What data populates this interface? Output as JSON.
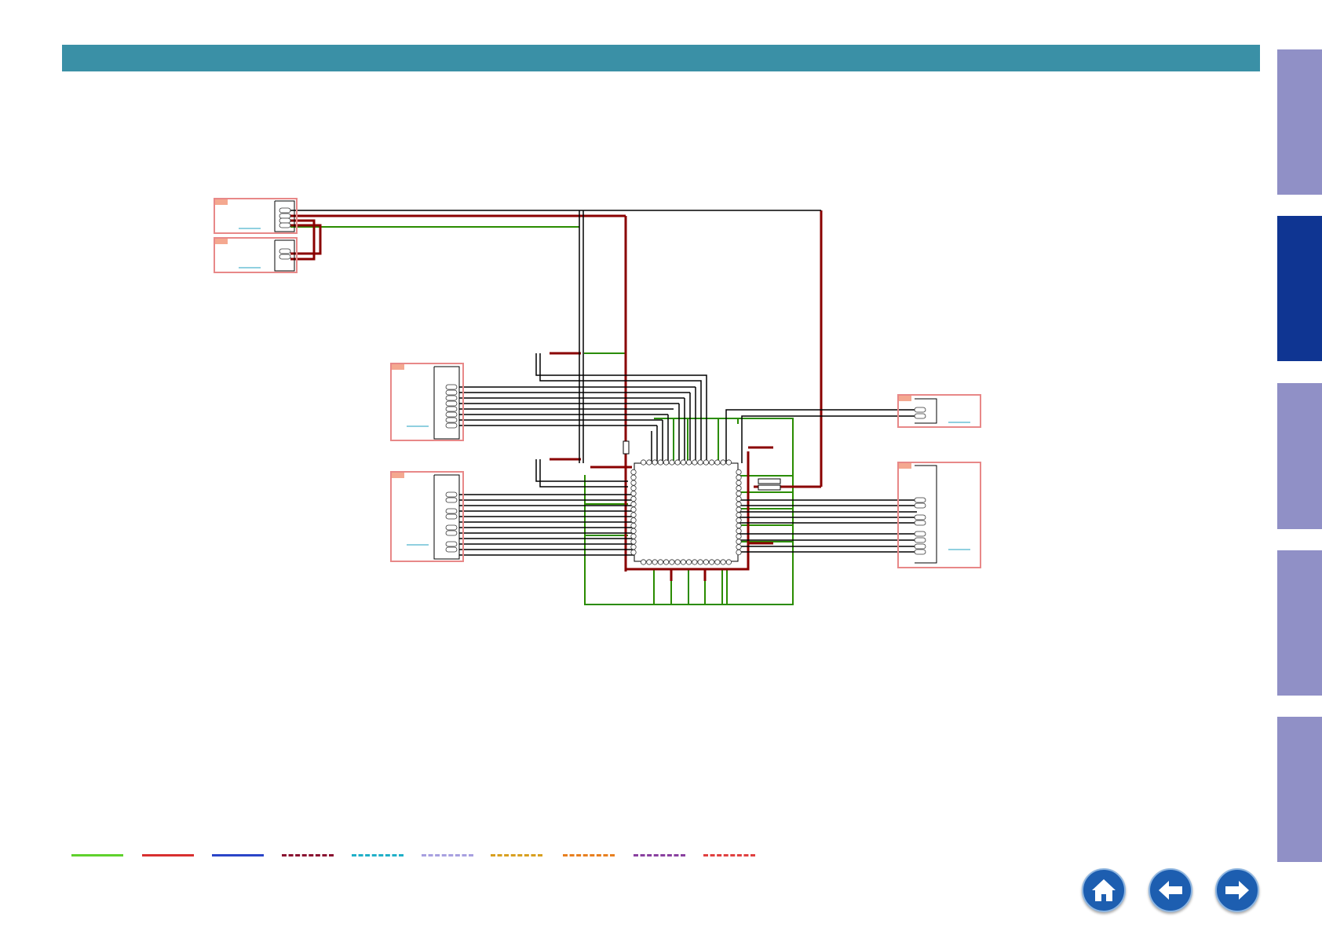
{
  "page": {
    "title": ""
  },
  "colors": {
    "header": "#3a90a6",
    "tab_inactive": "#9090c6",
    "tab_active": "#0f3592",
    "wire_ground": "#2a8c00",
    "wire_power": "#b00000",
    "wire_signal": "#000000",
    "connector_box": "#e88888",
    "nav_button": "#1d5eb0"
  },
  "side_tabs": [
    {
      "name": "side-tab-1",
      "active": false
    },
    {
      "name": "side-tab-2",
      "active": true
    },
    {
      "name": "side-tab-3",
      "active": false
    },
    {
      "name": "side-tab-4",
      "active": false
    },
    {
      "name": "side-tab-5",
      "active": false
    }
  ],
  "legend": [
    {
      "color": "#5fd12d",
      "style": "solid"
    },
    {
      "color": "#d83030",
      "style": "solid"
    },
    {
      "color": "#2a45c8",
      "style": "solid"
    },
    {
      "color": "#8a1030",
      "style": "dashed"
    },
    {
      "color": "#20b0c8",
      "style": "dashed"
    },
    {
      "color": "#a8a0e0",
      "style": "dashed"
    },
    {
      "color": "#d8a020",
      "style": "dashed"
    },
    {
      "color": "#e88020",
      "style": "dashed"
    },
    {
      "color": "#8a40a0",
      "style": "dashed"
    },
    {
      "color": "#e04040",
      "style": "dashed"
    }
  ],
  "nav": {
    "home": "home-icon",
    "back": "arrow-left-icon",
    "forward": "arrow-right-icon"
  }
}
